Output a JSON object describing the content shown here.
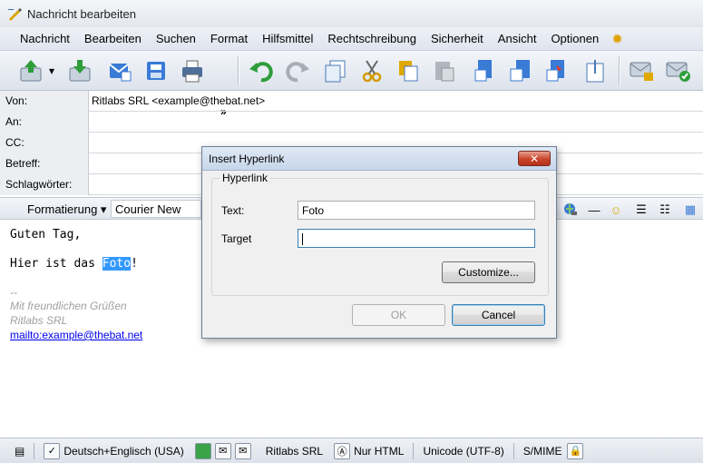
{
  "window": {
    "title": "Nachricht bearbeiten"
  },
  "menu": [
    "Nachricht",
    "Bearbeiten",
    "Suchen",
    "Format",
    "Hilfsmittel",
    "Rechtschreibung",
    "Sicherheit",
    "Ansicht",
    "Optionen"
  ],
  "toolbar": {
    "overflow": "»"
  },
  "fields": {
    "from_label": "Von:",
    "from_value": "Ritlabs SRL <example@thebat.net>",
    "to_label": "An:",
    "to_value": "",
    "cc_label": "CC:",
    "cc_value": "",
    "subject_label": "Betreff:",
    "subject_value": "",
    "keywords_label": "Schlagwörter:",
    "keywords_value": ""
  },
  "format": {
    "button": "Formatierung",
    "font": "Courier New"
  },
  "editor": {
    "greeting": "Guten Tag,",
    "body_before": "Hier ist das ",
    "body_selected": "Foto",
    "body_after": "!",
    "sig_sep": "--",
    "sig_line1": "Mit freundlichen Grüßen",
    "sig_line2": "Ritlabs SRL",
    "sig_link": "mailto:example@thebat.net"
  },
  "status": {
    "spell": "Deutsch+Englisch (USA)",
    "identity": "Ritlabs SRL",
    "mode": "Nur HTML",
    "encoding": "Unicode (UTF-8)",
    "security": "S/MIME"
  },
  "dialog": {
    "title": "Insert Hyperlink",
    "group": "Hyperlink",
    "text_label": "Text:",
    "text_value": "Foto",
    "target_label": "Target",
    "target_value": "",
    "customize": "Customize...",
    "ok": "OK",
    "cancel": "Cancel"
  }
}
